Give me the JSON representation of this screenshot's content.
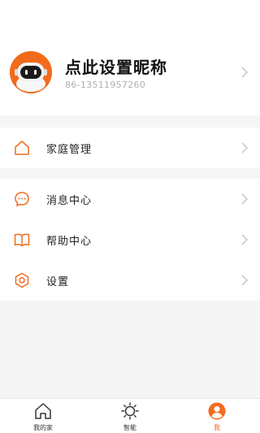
{
  "theme": {
    "accent": "#f26b1d",
    "background": "#f5f5f5"
  },
  "header": {
    "scan_icon": "scan-icon"
  },
  "profile": {
    "nickname": "点此设置昵称",
    "phone": "86-13511957260",
    "avatar_icon": "robot-avatar"
  },
  "menu": {
    "home_manage": {
      "label": "家庭管理",
      "icon": "home-icon"
    },
    "messages": {
      "label": "消息中心",
      "icon": "chat-icon"
    },
    "help": {
      "label": "帮助中心",
      "icon": "book-icon"
    },
    "settings": {
      "label": "设置",
      "icon": "settings-icon"
    }
  },
  "tabbar": {
    "tabs": [
      {
        "label": "我的家",
        "icon": "home-icon",
        "active": false
      },
      {
        "label": "智能",
        "icon": "sun-icon",
        "active": false
      },
      {
        "label": "我",
        "icon": "user-icon",
        "active": true
      }
    ]
  }
}
